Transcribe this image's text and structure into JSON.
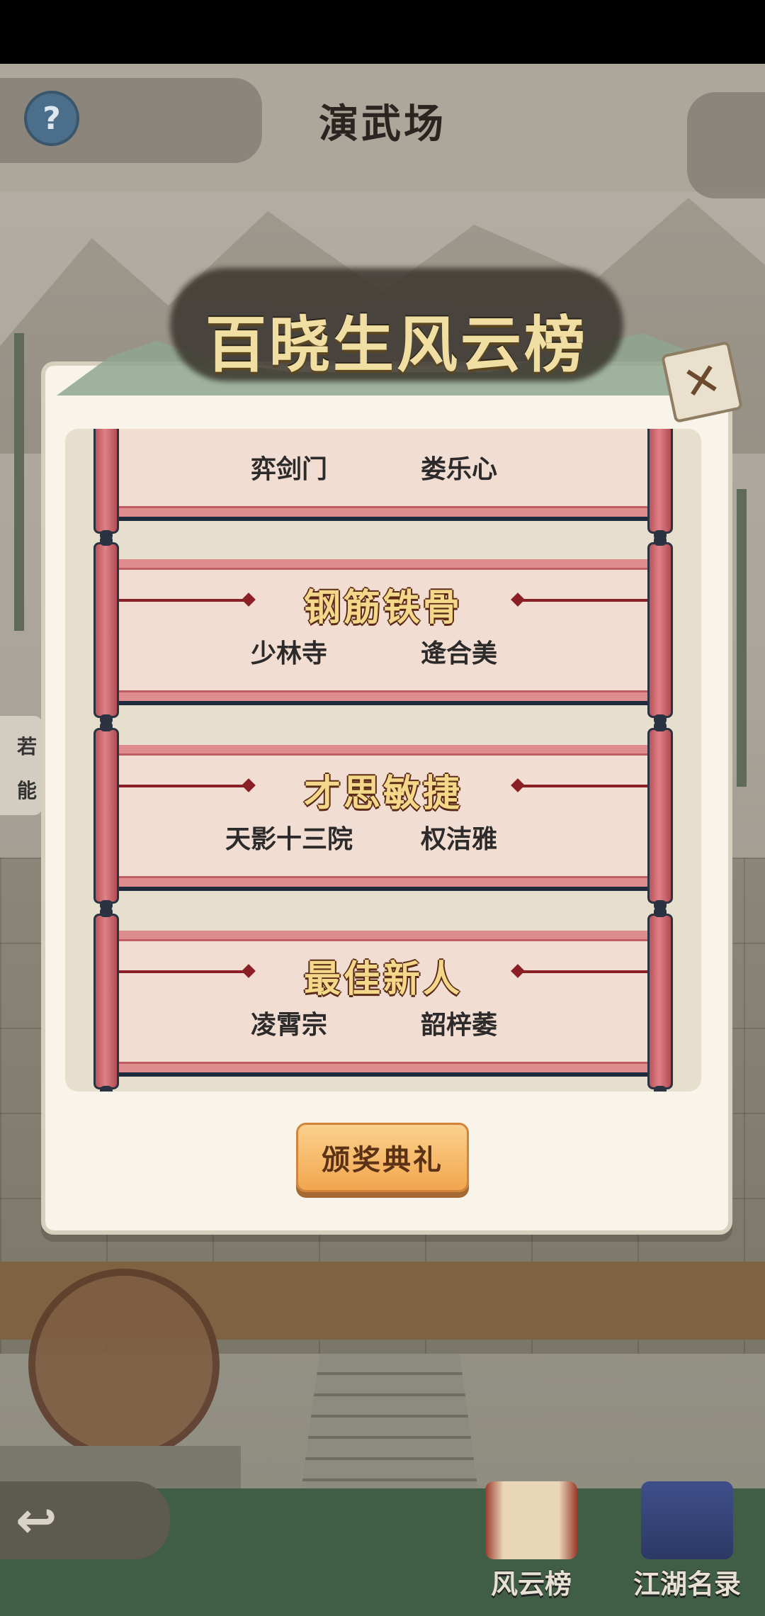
{
  "header": {
    "title": "演武场",
    "help_glyph": "?"
  },
  "side_tab": {
    "line1": "若",
    "line2": "能"
  },
  "modal": {
    "title": "百晓生风云榜",
    "close_glyph": "✕",
    "awards": [
      {
        "title": "",
        "sect": "弈剑门",
        "winner": "娄乐心"
      },
      {
        "title": "钢筋铁骨",
        "sect": "少林寺",
        "winner": "逄合美"
      },
      {
        "title": "才思敏捷",
        "sect": "天影十三院",
        "winner": "权洁雅"
      },
      {
        "title": "最佳新人",
        "sect": "凌霄宗",
        "winner": "韶梓萎"
      }
    ],
    "ceremony_button": "颁奖典礼"
  },
  "bottom_nav": {
    "back_glyph": "↩",
    "items": [
      {
        "label": "风云榜",
        "icon": "scroll-ranking-icon"
      },
      {
        "label": "江湖名录",
        "icon": "book-directory-icon"
      }
    ]
  },
  "colors": {
    "accent_gold": "#f3d889",
    "scroll_red": "#df8c8f",
    "button_orange": "#f2a64e"
  }
}
